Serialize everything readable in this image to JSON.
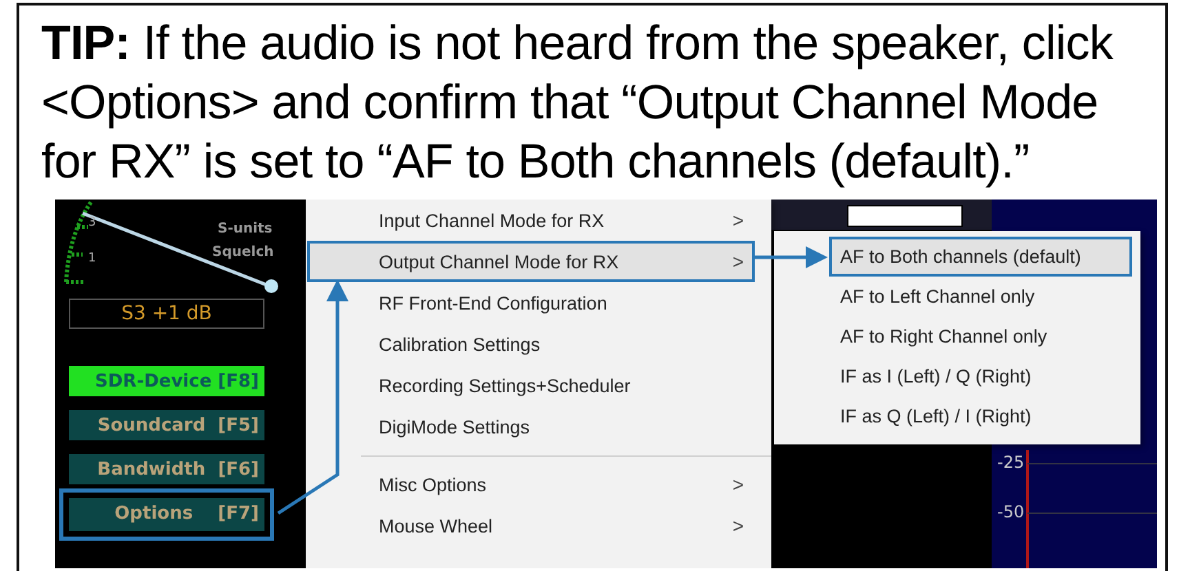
{
  "tip": {
    "text": "**TIP:** If the audio is not heard from the speaker, click <Options> and confirm that “Output Channel Mode for RX” is set to “AF to Both channels (default).”"
  },
  "screenshot": {
    "meter": {
      "scale_labels": [
        "3",
        "1"
      ],
      "labels": [
        "S-units",
        "Squelch"
      ],
      "reading": "S3 +1 dB"
    },
    "buttons": [
      {
        "label": "SDR-Device [F8]",
        "active": true,
        "callout": false
      },
      {
        "label": "Soundcard  [F5]",
        "active": false,
        "callout": false
      },
      {
        "label": "Bandwidth  [F6]",
        "active": false,
        "callout": false
      },
      {
        "label": "Options    [F7]",
        "active": false,
        "callout": true
      }
    ],
    "menu": {
      "items": [
        {
          "kind": "item",
          "label": "Input Channel Mode for RX",
          "arrow": ">",
          "selected": false
        },
        {
          "kind": "item",
          "label": "Output Channel Mode for RX",
          "arrow": ">",
          "selected": true
        },
        {
          "kind": "item",
          "label": "RF Front-End Configuration",
          "selected": false
        },
        {
          "kind": "item",
          "label": "Calibration Settings",
          "selected": false
        },
        {
          "kind": "item",
          "label": "Recording Settings+Scheduler",
          "selected": false
        },
        {
          "kind": "item",
          "label": "DigiMode Settings",
          "selected": false
        },
        {
          "kind": "separator"
        },
        {
          "kind": "item",
          "label": "Misc Options",
          "arrow": ">",
          "selected": false
        },
        {
          "kind": "item",
          "label": "Mouse Wheel",
          "arrow": ">",
          "selected": false
        }
      ]
    },
    "submenu": {
      "items": [
        {
          "kind": "item",
          "label": "AF to Both channels (default)",
          "selected": true
        },
        {
          "kind": "item",
          "label": "AF to Left Channel only",
          "selected": false
        },
        {
          "kind": "item",
          "label": "AF to Right Channel only",
          "selected": false
        },
        {
          "kind": "item",
          "label": "IF as I (Left) / Q (Right)",
          "selected": false
        },
        {
          "kind": "item",
          "label": "IF as Q (Left) / I (Right)",
          "selected": false
        }
      ]
    },
    "spectrum": {
      "axis_labels": [
        "-25",
        "-50"
      ]
    }
  }
}
